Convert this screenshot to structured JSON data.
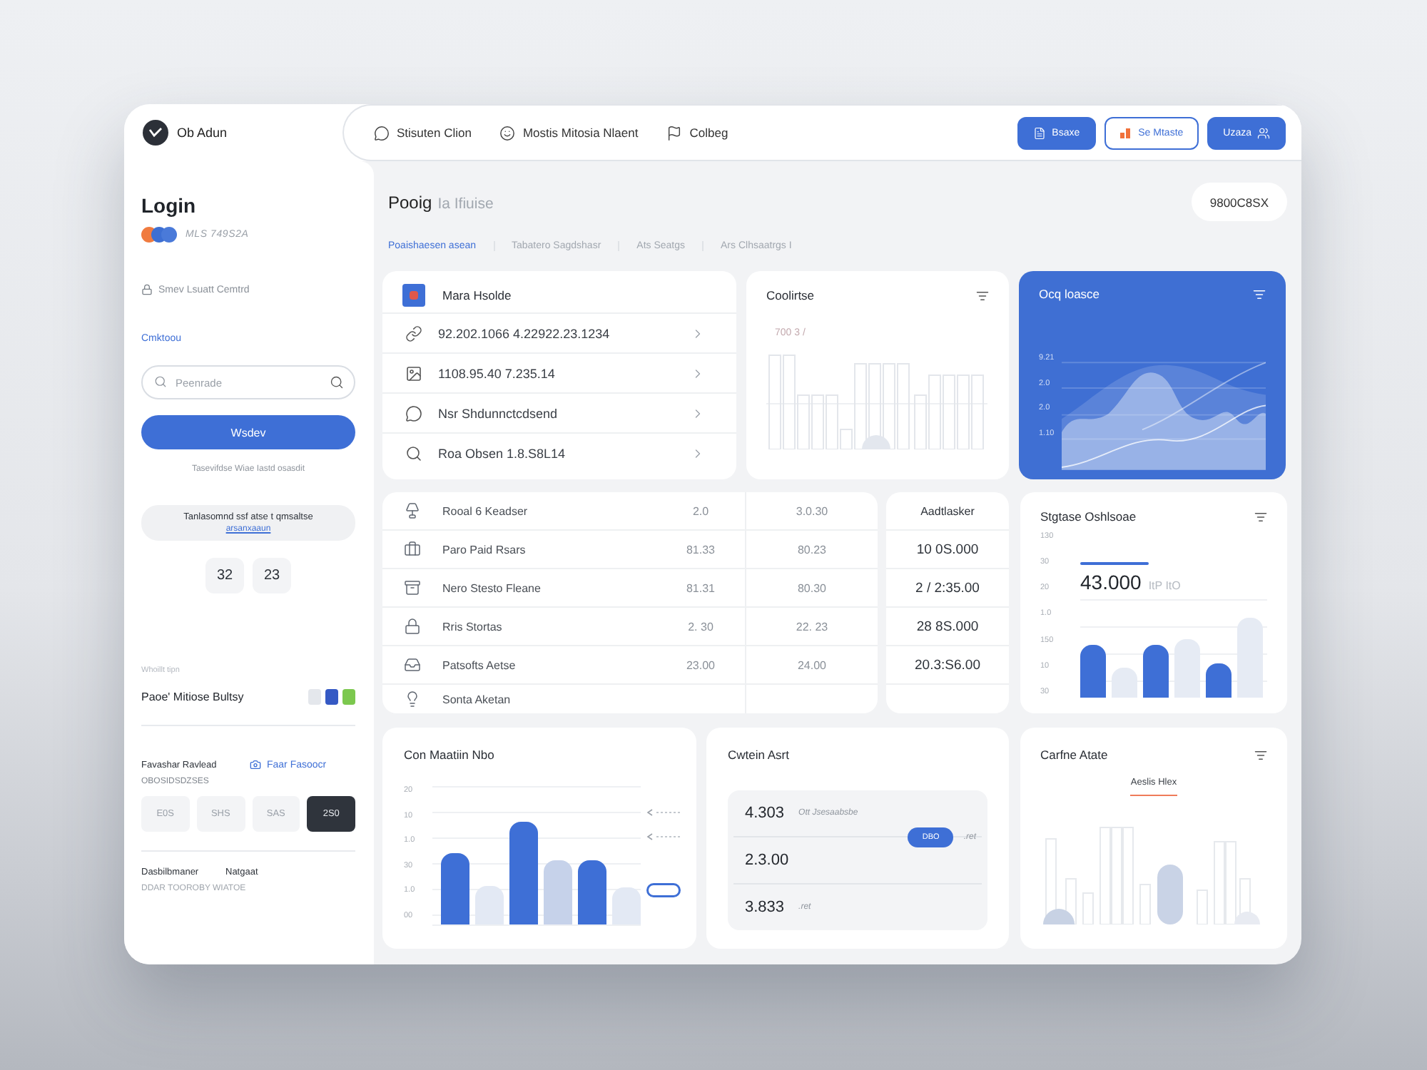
{
  "topbar": {
    "brand": "Ob Adun",
    "nav": [
      "Stisuten Clion",
      "Mostis Mitosia Nlaent",
      "Colbeg"
    ],
    "actions": [
      {
        "kind": "filled",
        "label": "Bsaxe"
      },
      {
        "kind": "outlined",
        "label": "Se Mtaste"
      },
      {
        "kind": "filled",
        "label": "Uzaza"
      }
    ]
  },
  "sidebar": {
    "title": "Login",
    "dots": [
      {
        "color": "#f07b3f"
      },
      {
        "color": "#3d6fd3"
      },
      {
        "color": "#4a7ad9"
      }
    ],
    "account_id": "MLS 749S2A",
    "workspace": "Smev Lsuatt Cemtrd",
    "link": "Cmktoou",
    "search": {
      "placeholder": "Peenrade"
    },
    "primary_button": "Wsdev",
    "hint": "Tasevifdse Wiae Iastd osasdit",
    "notice": {
      "text": "Tanlasomnd ssf atse t qmsaltse",
      "link": "arsanxaaun"
    },
    "counters": [
      "32",
      "23"
    ],
    "caption": "Whoillt tipn",
    "profile": {
      "name": "Paoe' Mitiose Bultsy",
      "swatches": [
        {
          "color": "#e4e7ec"
        },
        {
          "color": "#3559c4"
        },
        {
          "color": "#7cc84e"
        }
      ]
    },
    "plan": {
      "label": "Favashar Ravlead",
      "link": "Faar Fasoocr",
      "code": "OBOSIDSDZSES",
      "options": [
        {
          "label": "E0S",
          "selected": false
        },
        {
          "label": "SHS",
          "selected": false
        },
        {
          "label": "SAS",
          "selected": false
        },
        {
          "label": "2S0",
          "selected": true
        }
      ]
    },
    "footer": {
      "label": "Dasbilbmaner",
      "value": "Natgaat",
      "note": "DDAR TOOROBY WIATOE"
    }
  },
  "main": {
    "title": "Pooig",
    "subtitle": "Ia Ifiuise",
    "badge": "9800C8SX",
    "tabs": [
      {
        "label": "Poaishaesen asean",
        "selected": true
      },
      {
        "label": "Tabatero Sagdshasr",
        "selected": false
      },
      {
        "label": "Ats Seatgs",
        "selected": false
      },
      {
        "label": "Ars Clhsaatrgs I",
        "selected": false
      }
    ]
  },
  "devices_card": {
    "title": "Mara Hsolde",
    "items": [
      "92.202.1066 4.22922.23.1234",
      "1108.95.40 7.235.14",
      "Nsr Shdunnctcdsend",
      "Roa Obsen 1.8.S8L14"
    ]
  },
  "bars_card": {
    "title": "Coolirtse",
    "label": "700 3 /"
  },
  "area_card": {
    "title": "Ocq loasce",
    "y_labels": [
      "9.21",
      "2.0",
      "2.0",
      "1.10"
    ]
  },
  "records": [
    {
      "name": "Rooal 6 Keadser",
      "value_a": "2.0",
      "value_b": "3.0.30",
      "total": "Aadtlasker"
    },
    {
      "name": "Paro Paid Rsars",
      "value_a": "81.33",
      "value_b": "80.23",
      "total": "10 0S.000"
    },
    {
      "name": "Nero Stesto Fleane",
      "value_a": "81.31",
      "value_b": "80.30",
      "total": "2 / 2:35.00"
    },
    {
      "name": "Rris Stortas",
      "value_a": "2. 30",
      "value_b": "22. 23",
      "total": "28 8S.000"
    },
    {
      "name": "Patsofts Aetse",
      "value_a": "23.00",
      "value_b": "24.00",
      "total": "20.3:S6.00"
    },
    {
      "name": "Sonta Aketan"
    }
  ],
  "stats_card": {
    "title": "Stgtase Oshlsoae",
    "value": "43.000",
    "unit": "ItP ItO",
    "y_labels": [
      "130",
      "30",
      "20",
      "1.0",
      "150",
      "10",
      "30"
    ]
  },
  "activity_card": {
    "title": "Con Maatiin Nbo",
    "y_labels": [
      "20",
      "10",
      "1.0",
      "30",
      "1.0",
      "00"
    ]
  },
  "summary_card": {
    "title": "Cwtein Asrt",
    "rows": [
      {
        "value": "4.303",
        "note": "Ott Jsesaabsbe"
      },
      {
        "value": "2.3.00",
        "button": "DBO",
        "note": ".ret"
      },
      {
        "value": "3.833",
        "note": ".ret"
      }
    ]
  },
  "trend_card": {
    "title": "Carfne Atate",
    "tab": "Aeslis Hlex"
  }
}
